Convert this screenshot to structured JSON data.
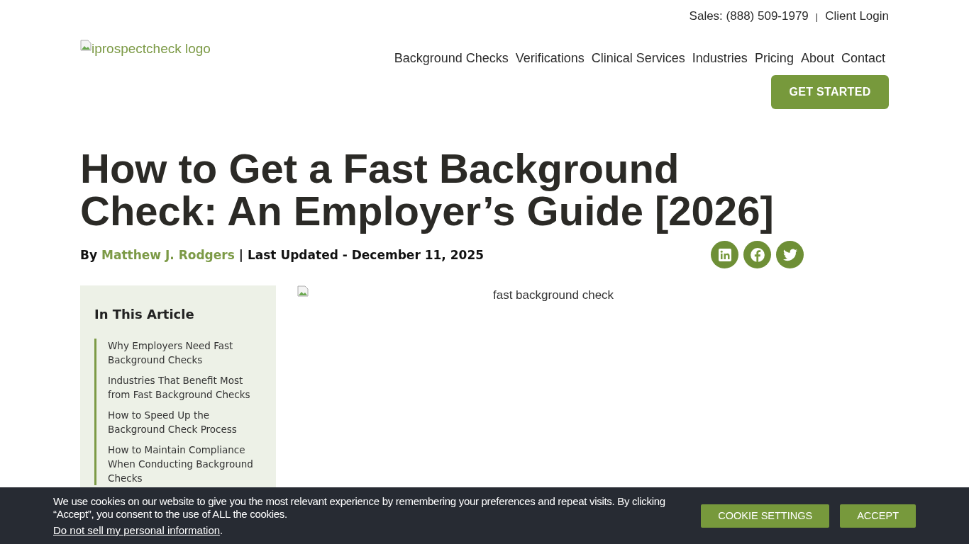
{
  "top_bar": {
    "sales": "Sales: (888) 509-1979",
    "separator": "|",
    "login": "Client Login"
  },
  "logo": {
    "alt": "iprospectcheck logo"
  },
  "nav": [
    "Background Checks",
    "Verifications",
    "Clinical Services",
    "Industries",
    "Pricing",
    "About",
    "Contact"
  ],
  "cta": "GET STARTED",
  "article": {
    "title": "How to Get a Fast Background Check: An Employer’s Guide [2026]",
    "by": "By",
    "author": "Matthew J. Rodgers",
    "updated": "| Last Updated - December 11, 2025",
    "share": [
      {
        "kind": "linkedin"
      },
      {
        "kind": "facebook"
      },
      {
        "kind": "twitter"
      }
    ],
    "image_alt": "fast background check"
  },
  "toc": {
    "title": "In This Article",
    "items": [
      "Why Employers Need Fast Background Checks",
      "Industries That Benefit Most from Fast Background Checks",
      "How to Speed Up the Background Check Process",
      "How to Maintain Compliance When Conducting Background Checks"
    ]
  },
  "cookie_banner": {
    "text": "We use cookies on our website to give you the most relevant experience by remembering your preferences and repeat visits. By clicking “Accept”, you consent to the use of ALL the cookies.",
    "link": "Do not sell my personal information",
    "link_after": ".",
    "buttons": [
      "COOKIE SETTINGS",
      "ACCEPT"
    ]
  }
}
